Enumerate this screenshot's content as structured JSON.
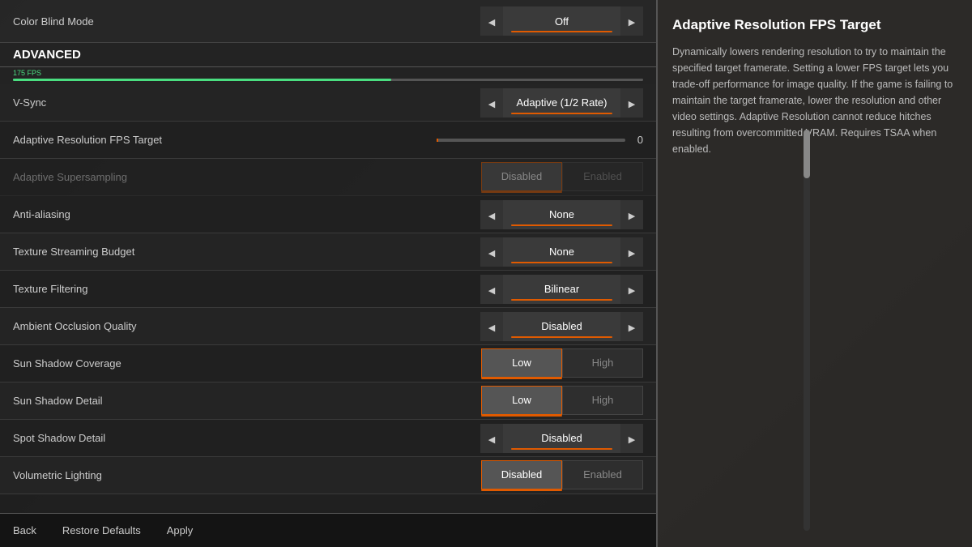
{
  "colorBlindMode": {
    "label": "Color Blind Mode",
    "value": "Off"
  },
  "advanced": {
    "header": "ADVANCED",
    "fpsLabel": "175 FPS"
  },
  "settings": [
    {
      "id": "vsync",
      "label": "V-Sync",
      "type": "arrow",
      "value": "Adaptive (1/2 Rate)"
    },
    {
      "id": "adaptive-resolution",
      "label": "Adaptive Resolution FPS Target",
      "type": "slider",
      "value": "0"
    },
    {
      "id": "adaptive-supersampling",
      "label": "Adaptive Supersampling",
      "type": "toggle2",
      "left": "Disabled",
      "right": "Enabled",
      "active": "left",
      "disabled": true
    },
    {
      "id": "anti-aliasing",
      "label": "Anti-aliasing",
      "type": "arrow",
      "value": "None"
    },
    {
      "id": "texture-streaming",
      "label": "Texture Streaming Budget",
      "type": "arrow",
      "value": "None"
    },
    {
      "id": "texture-filtering",
      "label": "Texture Filtering",
      "type": "arrow",
      "value": "Bilinear"
    },
    {
      "id": "ambient-occlusion",
      "label": "Ambient Occlusion Quality",
      "type": "arrow",
      "value": "Disabled"
    },
    {
      "id": "sun-shadow-coverage",
      "label": "Sun Shadow Coverage",
      "type": "toggle2",
      "left": "Low",
      "right": "High",
      "active": "left",
      "disabled": false
    },
    {
      "id": "sun-shadow-detail",
      "label": "Sun Shadow Detail",
      "type": "toggle2",
      "left": "Low",
      "right": "High",
      "active": "left",
      "disabled": false
    },
    {
      "id": "spot-shadow-detail",
      "label": "Spot Shadow Detail",
      "type": "arrow",
      "value": "Disabled"
    },
    {
      "id": "volumetric-lighting",
      "label": "Volumetric Lighting",
      "type": "toggle2",
      "left": "Disabled",
      "right": "Enabled",
      "active": "left",
      "disabled": false
    }
  ],
  "bottomBar": {
    "back": "Back",
    "restoreDefaults": "Restore Defaults",
    "apply": "Apply"
  },
  "infoPanel": {
    "title": "Adaptive Resolution FPS Target",
    "body": "Dynamically lowers rendering resolution to try to maintain the specified target framerate. Setting a lower FPS target lets you trade-off performance for image quality. If the game is failing to maintain the target framerate, lower the resolution and other video settings. Adaptive Resolution cannot reduce hitches resulting from overcommitted VRAM. Requires TSAA when enabled."
  }
}
